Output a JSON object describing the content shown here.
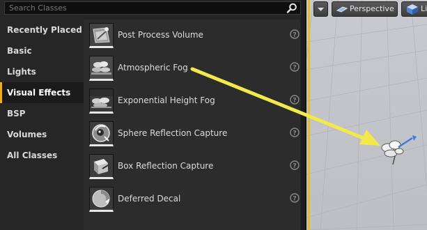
{
  "search": {
    "placeholder": "Search Classes",
    "value": ""
  },
  "categories": [
    {
      "label": "Recently Placed"
    },
    {
      "label": "Basic"
    },
    {
      "label": "Lights"
    },
    {
      "label": "Visual Effects",
      "active": true
    },
    {
      "label": "BSP"
    },
    {
      "label": "Volumes"
    },
    {
      "label": "All Classes"
    }
  ],
  "items": [
    {
      "label": "Post Process Volume",
      "icon": "post-process-volume-icon"
    },
    {
      "label": "Atmospheric Fog",
      "icon": "atmospheric-fog-icon"
    },
    {
      "label": "Exponential Height Fog",
      "icon": "exponential-height-fog-icon"
    },
    {
      "label": "Sphere Reflection Capture",
      "icon": "sphere-reflection-capture-icon"
    },
    {
      "label": "Box Reflection Capture",
      "icon": "box-reflection-capture-icon"
    },
    {
      "label": "Deferred Decal",
      "icon": "deferred-decal-icon"
    }
  ],
  "viewport": {
    "perspective_label": "Perspective",
    "lit_label": "Lit"
  },
  "colors": {
    "accent": "#f5ac19",
    "viewport_highlight": "#e0c12c",
    "annotation_arrow": "#f4e94a"
  }
}
